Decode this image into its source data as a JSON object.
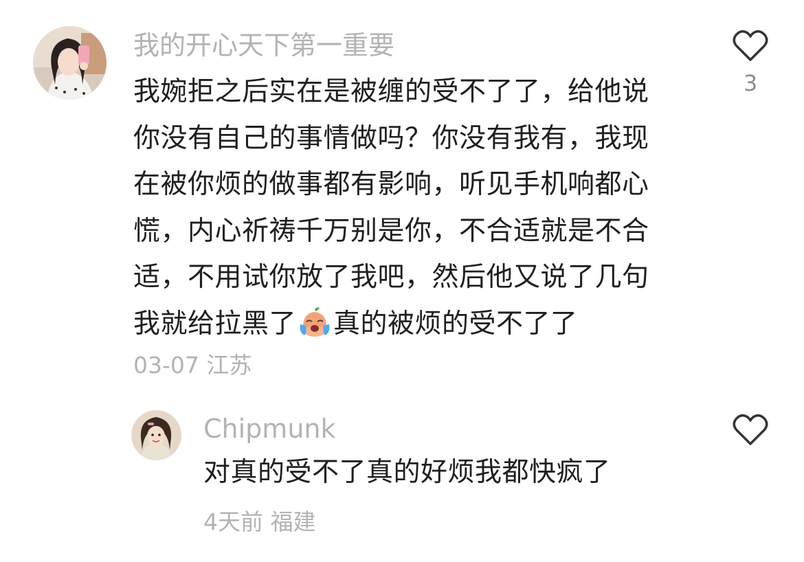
{
  "comments": [
    {
      "username": "我的开心天下第一重要",
      "body_lines": [
        "我婉拒之后实在是被缠的受不了了，给他说",
        "你没有自己的事情做吗？你没有我有，我现",
        "在被你烦的做事都有影响，听见手机响都心",
        "慌，内心祈祷千万别是你，不合适就是不合",
        "适，不用试你放了我吧，然后他又说了几句"
      ],
      "last_line_before": "我就给拉黑了",
      "emoji": "crying-face-emoji",
      "last_line_after": "真的被烦的受不了了",
      "date": "03-07",
      "location": "江苏",
      "like_count": "3",
      "icon": "heart-outline-icon"
    },
    {
      "username": "Chipmunk",
      "body": "对真的受不了真的好烦我都快疯了",
      "date": "4天前",
      "location": "福建",
      "icon": "heart-outline-icon"
    }
  ],
  "colors": {
    "username": "#b3b3b3",
    "body_text": "#1f1f1f",
    "meta_text": "#b3b3b3",
    "icon_stroke": "#333333"
  }
}
